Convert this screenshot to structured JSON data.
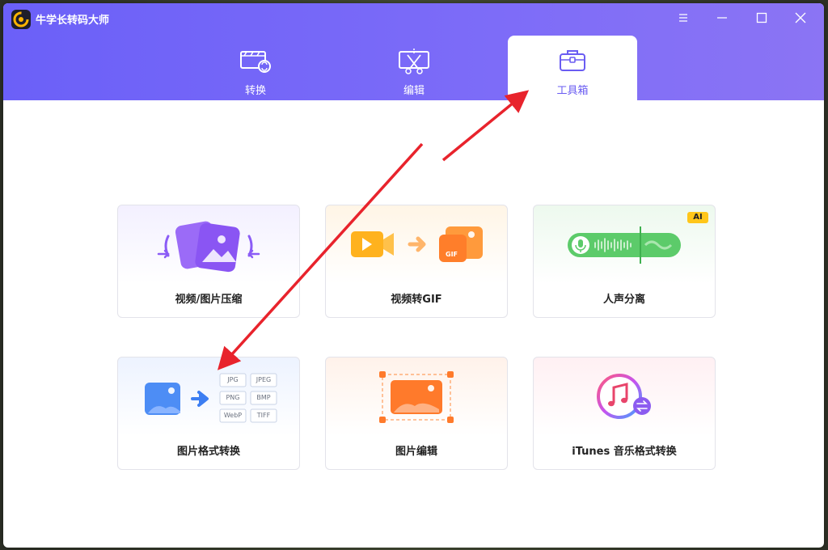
{
  "app": {
    "title": "牛学长转码大师"
  },
  "tabs": [
    {
      "label": "转换",
      "icon": "video-convert-icon"
    },
    {
      "label": "编辑",
      "icon": "video-edit-icon"
    },
    {
      "label": "工具箱",
      "icon": "toolbox-icon",
      "active": true
    }
  ],
  "tools": [
    {
      "label": "视频/图片压缩",
      "icon": "compress-icon"
    },
    {
      "label": "视频转GIF",
      "icon": "video-to-gif-icon"
    },
    {
      "label": "人声分离",
      "icon": "voice-separation-icon",
      "badge": "AI"
    },
    {
      "label": "图片格式转换",
      "icon": "image-convert-icon",
      "formats": [
        "JPG",
        "JPEG",
        "PNG",
        "BMP",
        "WebP",
        "TIFF"
      ]
    },
    {
      "label": "图片编辑",
      "icon": "image-edit-icon"
    },
    {
      "label": "iTunes 音乐格式转换",
      "icon": "itunes-convert-icon"
    }
  ],
  "gif_tag": "GIF",
  "colors": {
    "header": "#6b60f8",
    "active_tab_text": "#6a5cf2",
    "annotation_arrow": "#e8232c"
  }
}
